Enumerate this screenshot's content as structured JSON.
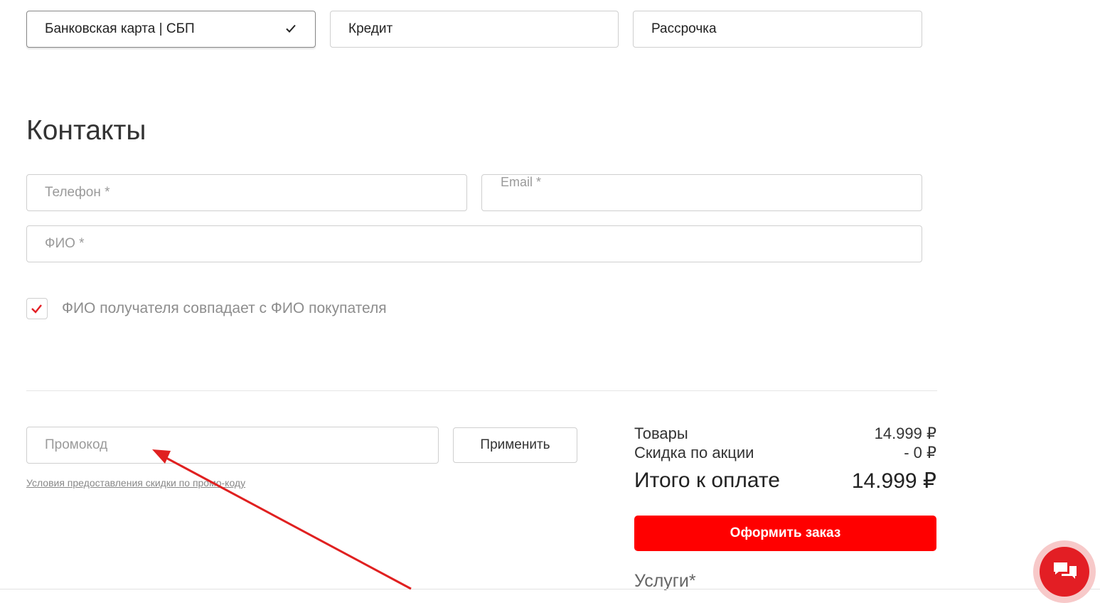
{
  "payment": {
    "tabs": [
      {
        "label": "Банковская карта | СБП",
        "selected": true
      },
      {
        "label": "Кредит",
        "selected": false
      },
      {
        "label": "Рассрочка",
        "selected": false
      }
    ]
  },
  "contacts": {
    "title": "Контакты",
    "phone_placeholder": "Телефон *",
    "email_placeholder": "Email *",
    "name_placeholder": "ФИО *",
    "same_name_label": "ФИО получателя совпадает с ФИО покупателя",
    "same_name_checked": true
  },
  "promo": {
    "placeholder": "Промокод",
    "apply_label": "Применить",
    "terms_link": "Условия предоставления скидки по промо-коду"
  },
  "summary": {
    "items_label": "Товары",
    "items_value": "14.999 ₽",
    "discount_label": "Скидка по акции",
    "discount_value": "- 0 ₽",
    "total_label": "Итого к оплате",
    "total_value": "14.999 ₽",
    "order_button": "Оформить заказ",
    "services_label": "Услуги*"
  },
  "colors": {
    "accent": "#ff0000",
    "annotation_arrow": "#e02020",
    "chat_button": "#e31e24"
  }
}
